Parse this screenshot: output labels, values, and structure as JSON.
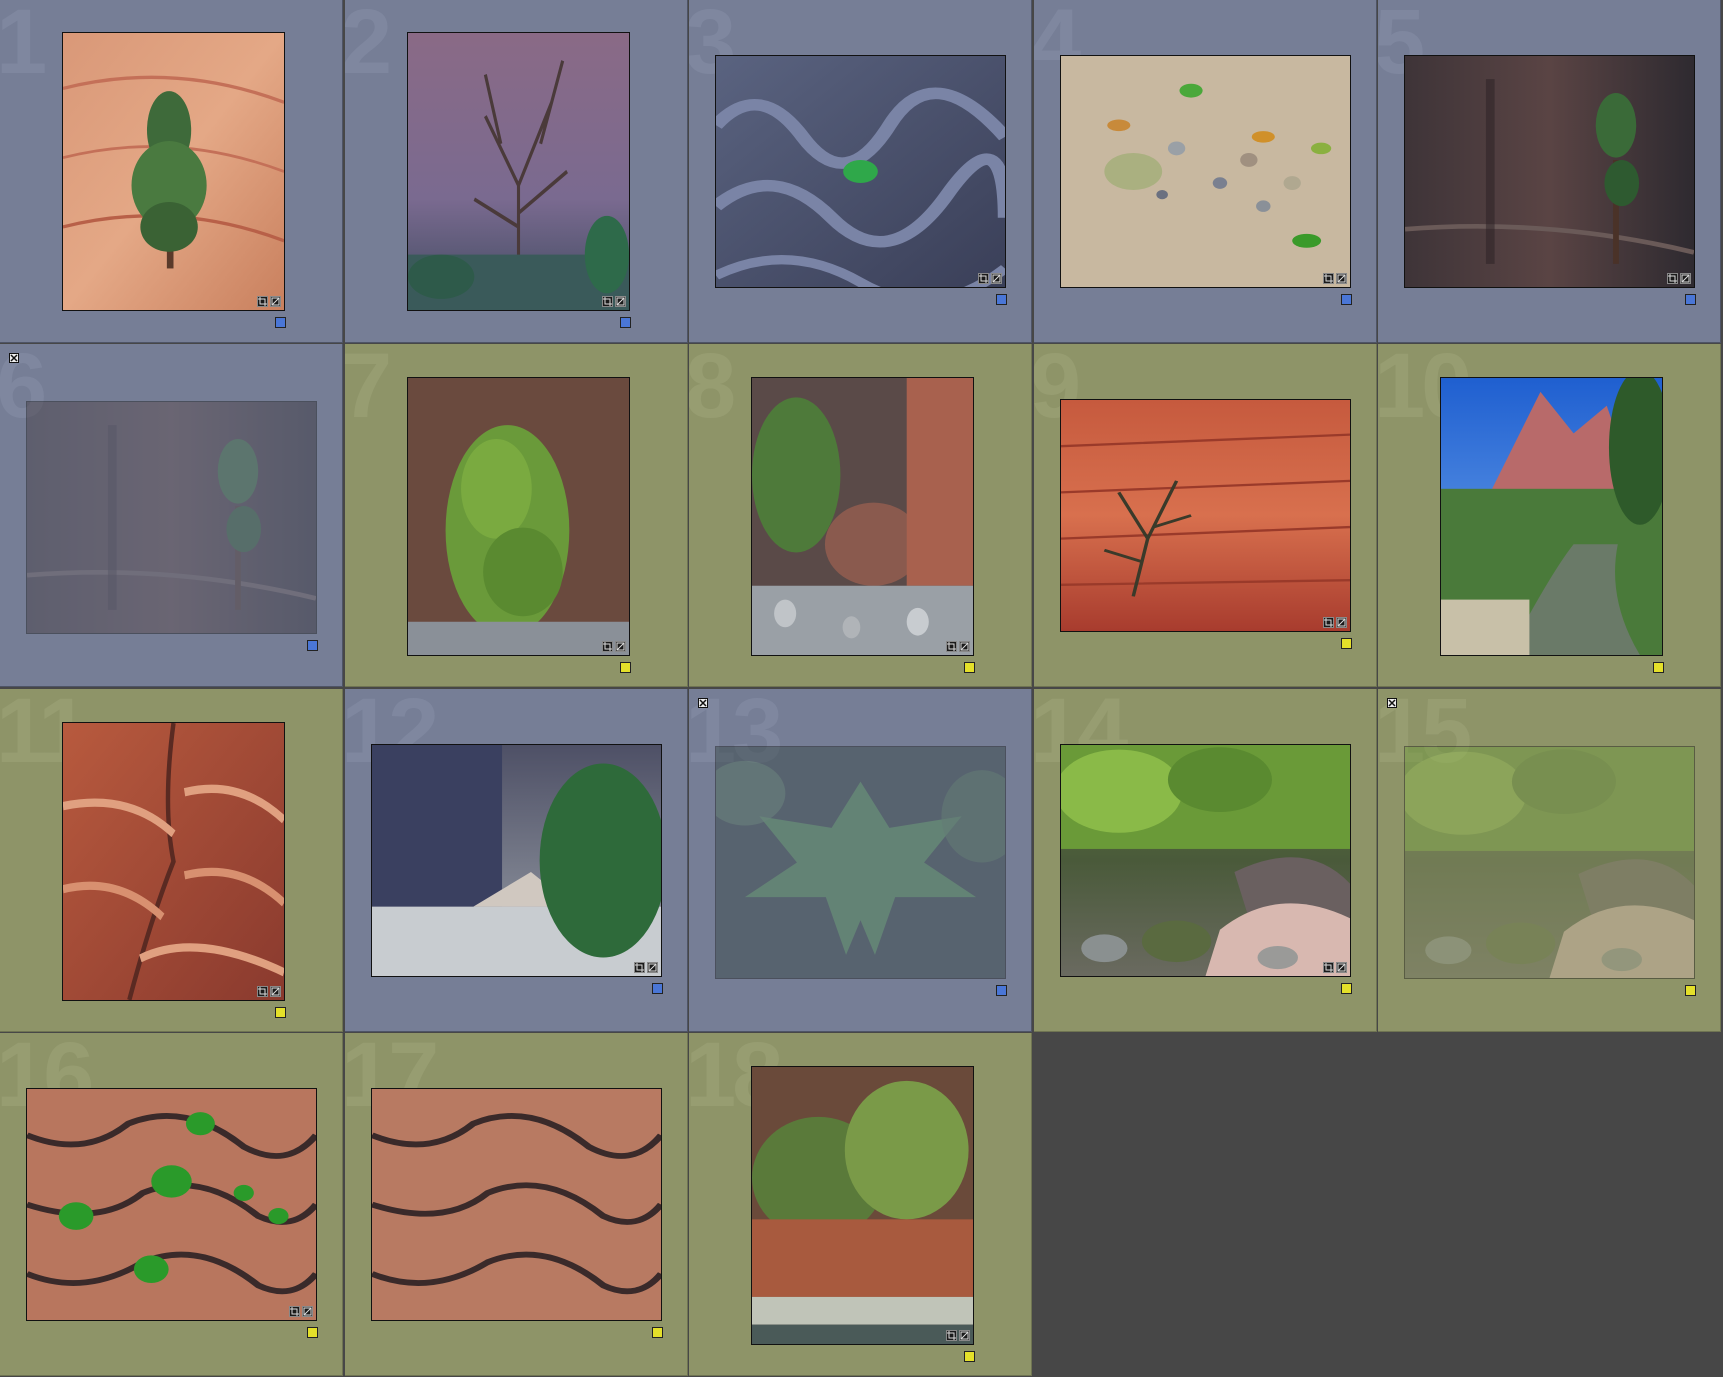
{
  "grid_columns": 5,
  "colors": {
    "cell_blue": "#767e96",
    "cell_olive": "#8e9468",
    "label_blue": "#4a76d6",
    "label_yellow": "#e4e02a",
    "background": "#474747"
  },
  "icons": {
    "crop": "crop-icon",
    "develop": "develop-adjust-icon",
    "reject": "reject-flag-icon",
    "label": "color-label-icon"
  },
  "thumbnails": [
    {
      "number": "1",
      "cell": "blue",
      "label": "blue",
      "rejected": false,
      "badges": true,
      "subject": "pine-on-slickrock"
    },
    {
      "number": "2",
      "cell": "blue",
      "label": "blue",
      "rejected": false,
      "badges": true,
      "subject": "bare-tree-cliff"
    },
    {
      "number": "3",
      "cell": "blue",
      "label": "blue",
      "rejected": false,
      "badges": true,
      "subject": "sand-ripples-leaf"
    },
    {
      "number": "4",
      "cell": "blue",
      "label": "blue",
      "rejected": false,
      "badges": true,
      "subject": "leaves-pebbles"
    },
    {
      "number": "5",
      "cell": "blue",
      "label": "blue",
      "rejected": false,
      "badges": true,
      "subject": "cliff-wall-pine"
    },
    {
      "number": "6",
      "cell": "blue",
      "label": "blue",
      "rejected": true,
      "badges": false,
      "subject": "cliff-wall-pine"
    },
    {
      "number": "7",
      "cell": "olive",
      "label": "yellow",
      "rejected": false,
      "badges": true,
      "subject": "green-shrub-wall"
    },
    {
      "number": "8",
      "cell": "olive",
      "label": "yellow",
      "rejected": false,
      "badges": true,
      "subject": "canyon-rocks"
    },
    {
      "number": "9",
      "cell": "olive",
      "label": "yellow",
      "rejected": false,
      "badges": true,
      "subject": "red-wall-shrub"
    },
    {
      "number": "10",
      "cell": "olive",
      "label": "yellow",
      "rejected": false,
      "badges": false,
      "subject": "river-mountain"
    },
    {
      "number": "11",
      "cell": "olive",
      "label": "yellow",
      "rejected": false,
      "badges": true,
      "subject": "red-sandstone"
    },
    {
      "number": "12",
      "cell": "blue",
      "label": "blue",
      "rejected": false,
      "badges": true,
      "subject": "narrows-tree"
    },
    {
      "number": "13",
      "cell": "blue",
      "label": "blue",
      "rejected": true,
      "badges": false,
      "subject": "maple-leaf"
    },
    {
      "number": "14",
      "cell": "olive",
      "label": "yellow",
      "rejected": false,
      "badges": true,
      "subject": "creek-boulders"
    },
    {
      "number": "15",
      "cell": "olive",
      "label": "yellow",
      "rejected": true,
      "badges": false,
      "subject": "creek-boulders"
    },
    {
      "number": "16",
      "cell": "olive",
      "label": "yellow",
      "rejected": false,
      "badges": true,
      "subject": "cracked-rock-leaves"
    },
    {
      "number": "17",
      "cell": "olive",
      "label": "yellow",
      "rejected": false,
      "badges": false,
      "subject": "cracked-rock"
    },
    {
      "number": "18",
      "cell": "olive",
      "label": "yellow",
      "rejected": false,
      "badges": true,
      "subject": "riverbank-trees"
    }
  ]
}
